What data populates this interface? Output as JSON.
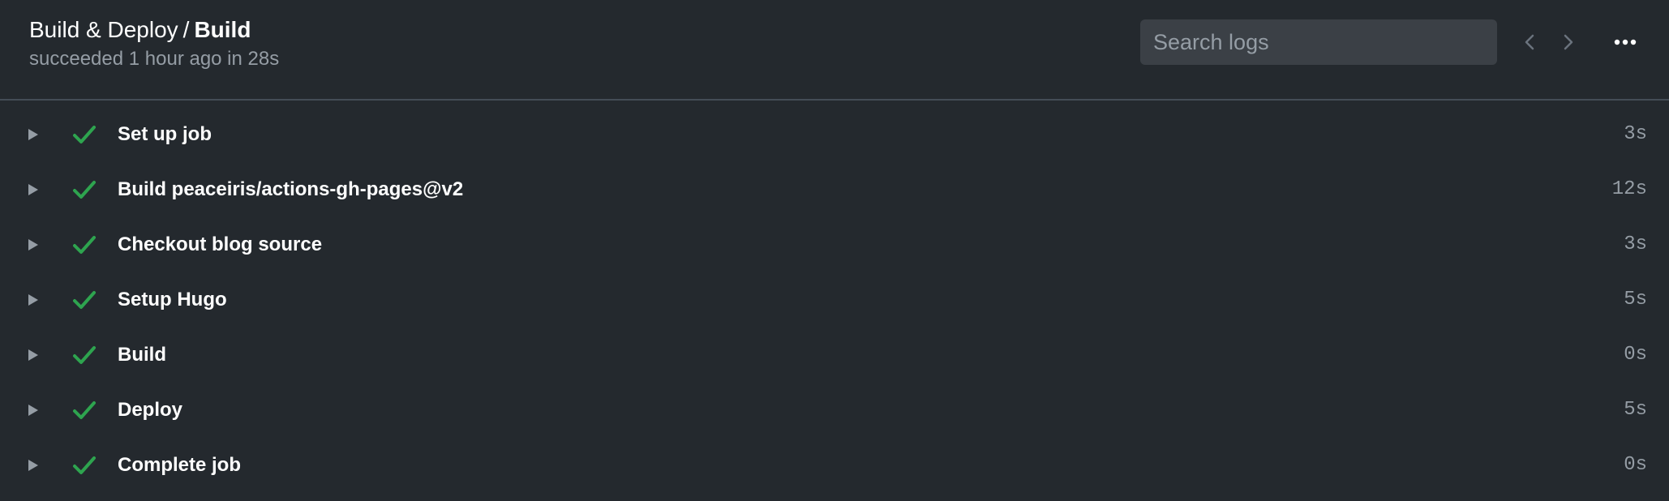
{
  "header": {
    "workflow": "Build & Deploy",
    "separator": "/",
    "job": "Build",
    "status": "succeeded 1 hour ago in 28s"
  },
  "search": {
    "placeholder": "Search logs",
    "value": ""
  },
  "icons": {
    "prev": "chevron-left-icon",
    "next": "chevron-right-icon",
    "more": "kebab-horizontal-icon",
    "expand": "triangle-right-icon",
    "success": "check-icon"
  },
  "colors": {
    "background": "#24292e",
    "success": "#2ea44f",
    "muted": "#959da5",
    "search_bg": "#3b4046"
  },
  "steps": [
    {
      "label": "Set up job",
      "duration": "3s"
    },
    {
      "label": "Build peaceiris/actions-gh-pages@v2",
      "duration": "12s"
    },
    {
      "label": "Checkout blog source",
      "duration": "3s"
    },
    {
      "label": "Setup Hugo",
      "duration": "5s"
    },
    {
      "label": "Build",
      "duration": "0s"
    },
    {
      "label": "Deploy",
      "duration": "5s"
    },
    {
      "label": "Complete job",
      "duration": "0s"
    }
  ]
}
